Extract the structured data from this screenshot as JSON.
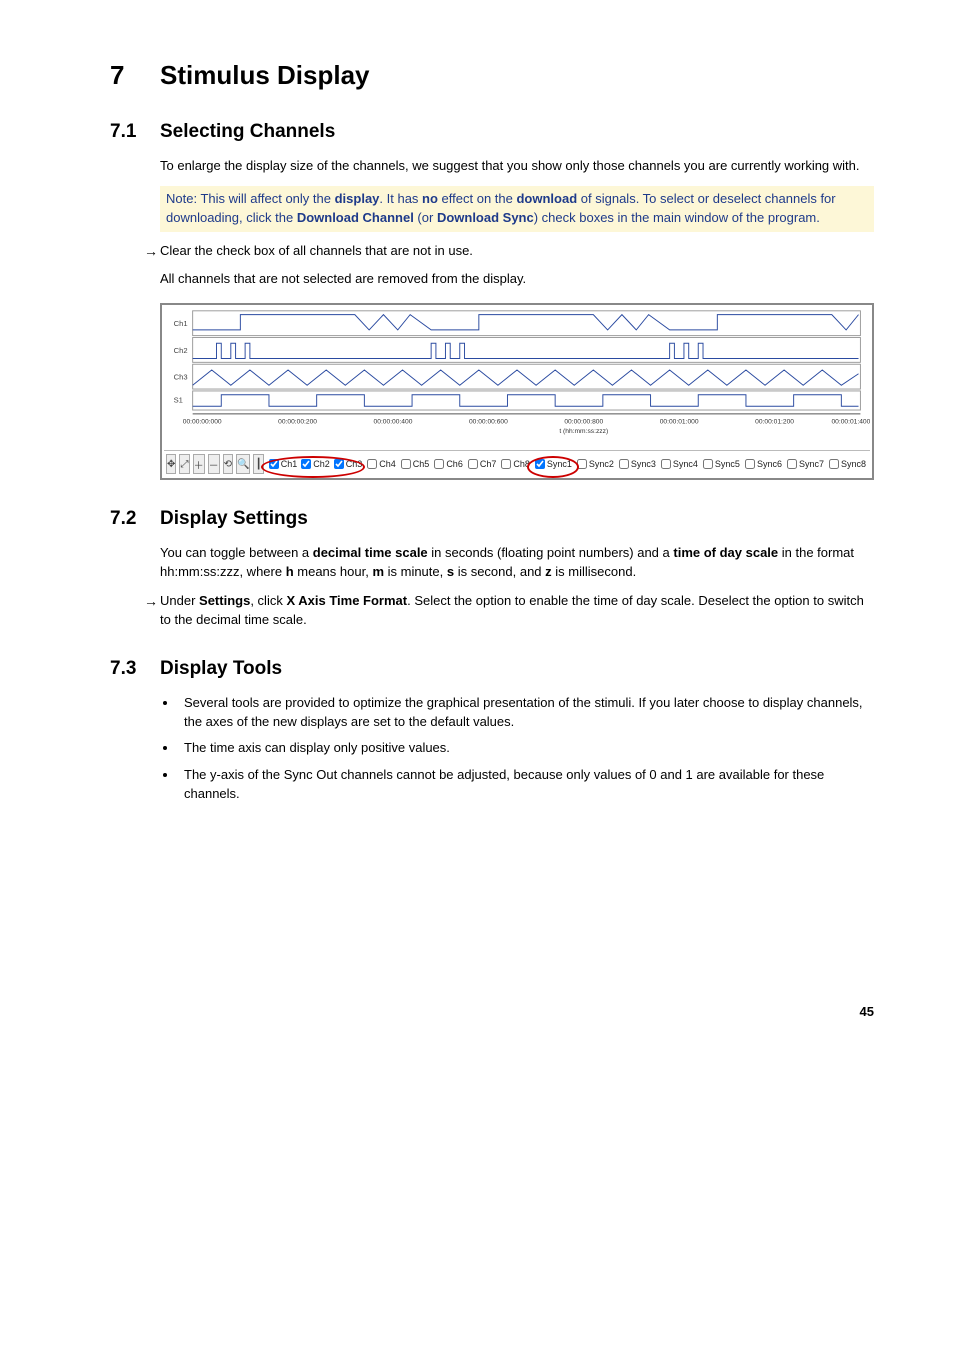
{
  "h1": {
    "num": "7",
    "title": "Stimulus Display"
  },
  "s71": {
    "num": "7.1",
    "title": "Selecting Channels",
    "p1": "To enlarge the display size of the channels, we suggest that you show only those channels you are currently working with.",
    "note_pre": "Note: This will affect only the ",
    "note_b1": "display",
    "note_mid1": ". It has ",
    "note_b2": "no",
    "note_mid2": " effect on the ",
    "note_b3": "download",
    "note_mid3": " of signals. To select or deselect channels for downloading, click the ",
    "note_b4": "Download Channel",
    "note_mid4": " (or ",
    "note_b5": "Download Sync",
    "note_mid5": ") check boxes in the main window of the program.",
    "arrow1": "Clear the check box of all channels that are not in use.",
    "p2": "All channels that are not selected are removed from the display."
  },
  "s72": {
    "num": "7.2",
    "title": "Display Settings",
    "p1_pre": "You can toggle between a ",
    "p1_b1": "decimal time scale",
    "p1_mid1": " in seconds (floating point numbers) and a ",
    "p1_b2": "time of day scale",
    "p1_mid2": " in the format hh:mm:ss:zzz, where ",
    "p1_b3": "h",
    "p1_mid3": " means hour, ",
    "p1_b4": "m",
    "p1_mid4": " is minute, ",
    "p1_b5": "s",
    "p1_mid5": " is second, and ",
    "p1_b6": "z",
    "p1_mid6": " is millisecond.",
    "arrow_pre": "Under ",
    "arrow_b1": "Settings",
    "arrow_mid1": ", click ",
    "arrow_b2": "X Axis Time Format",
    "arrow_mid2": ". Select the option to enable the time of day scale. Deselect the option to switch to the decimal time scale."
  },
  "s73": {
    "num": "7.3",
    "title": "Display Tools",
    "li1": "Several tools are provided to optimize the graphical presentation of the stimuli. If you later choose to display channels, the axes of the new displays are set to the default values.",
    "li2": "The time axis can display only positive values.",
    "li3": "The y-axis of the Sync Out channels cannot be adjusted, because only values of 0 and 1 are available for these channels."
  },
  "chart_data": {
    "type": "line",
    "xlabel": "t (hh:mm:ss:zzz)",
    "xticks": [
      "00:00:00:000",
      "00:00:00:200",
      "00:00:00:400",
      "00:00:00:600",
      "00:00:00:800",
      "00:00:01:000",
      "00:00:01:200",
      "00:00:01:400"
    ],
    "row_labels": [
      "Ch1",
      "Ch2",
      "Ch3",
      "S1"
    ],
    "panels": [
      {
        "name": "Ch1",
        "ylim": [
          -5000,
          5000
        ],
        "yticks": [
          -5000,
          0,
          5000
        ],
        "style": "square"
      },
      {
        "name": "Ch2",
        "ylim": [
          -5000,
          5000
        ],
        "yticks": [
          -5000,
          0,
          5000
        ],
        "style": "pulse-train"
      },
      {
        "name": "Ch3",
        "ylim": [
          -5000,
          5000
        ],
        "yticks": [
          -5000,
          0,
          5000
        ],
        "style": "triangle"
      },
      {
        "name": "S1",
        "ylim": [
          0,
          1
        ],
        "yticks": [
          0,
          1
        ],
        "style": "digital"
      }
    ]
  },
  "toolbar": {
    "buttons": [
      "move",
      "fit",
      "zoom-in",
      "zoom-out",
      "reset",
      "zoom-region",
      "cursor"
    ],
    "channels": [
      "Ch1",
      "Ch2",
      "Ch3",
      "Ch4",
      "Ch5",
      "Ch6",
      "Ch7",
      "Ch8"
    ],
    "channels_checked": [
      true,
      true,
      true,
      false,
      false,
      false,
      false,
      false
    ],
    "syncs": [
      "Sync1",
      "Sync2",
      "Sync3",
      "Sync4",
      "Sync5",
      "Sync6",
      "Sync7",
      "Sync8"
    ],
    "syncs_checked": [
      true,
      false,
      false,
      false,
      false,
      false,
      false,
      false
    ]
  },
  "pagenum": "45"
}
